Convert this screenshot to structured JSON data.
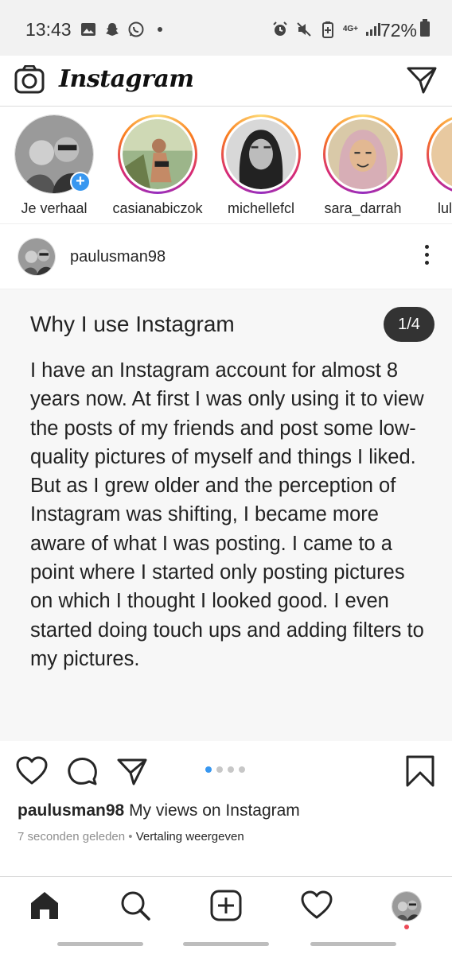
{
  "status_bar": {
    "time": "13:43",
    "network": "4G+",
    "battery": "72%",
    "left_icons": [
      "gallery-icon",
      "snapchat-icon",
      "whatsapp-icon",
      "dot-icon"
    ],
    "right_icons": [
      "alarm-icon",
      "mute-icon",
      "battery-saver-icon",
      "signal-icon"
    ]
  },
  "app_bar": {
    "logo": "Instagram"
  },
  "stories": [
    {
      "label": "Je verhaal",
      "own": true
    },
    {
      "label": "casianabiczok",
      "own": false
    },
    {
      "label": "michellefcl",
      "own": false
    },
    {
      "label": "sara_darrah",
      "own": false
    },
    {
      "label": "lul",
      "own": false
    }
  ],
  "post": {
    "username": "paulusman98",
    "title": "Why I use Instagram",
    "page_indicator": "1/4",
    "body": "I have an Instagram account for almost 8 years now. At first I was only using it to view the posts of my friends and post some low-quality pictures of myself and things I liked. But as I grew older and the perception of Instagram was shifting, I became more aware of what I was posting. I came to a point where I started only posting pictures on which I thought I looked good. I even started doing touch ups and adding filters to my pictures.",
    "carousel": {
      "count": 4,
      "active": 0
    },
    "caption_user": "paulusman98",
    "caption_text": "My views on Instagram",
    "timestamp": "7 seconden geleden",
    "separator": "•",
    "translate_label": "Vertaling weergeven"
  },
  "colors": {
    "accent": "#3897f0",
    "text": "#262626",
    "muted": "#8e8e8e",
    "notification": "#ed4956"
  }
}
